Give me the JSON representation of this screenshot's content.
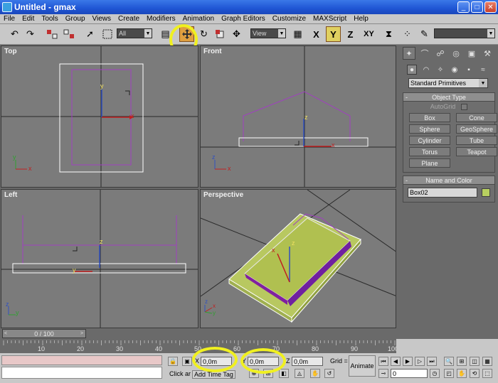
{
  "window": {
    "title": "Untitled - gmax",
    "minimize": "_",
    "maximize": "□",
    "close": "✕"
  },
  "menu": [
    "File",
    "Edit",
    "Tools",
    "Group",
    "Views",
    "Create",
    "Modifiers",
    "Animation",
    "Graph Editors",
    "Customize",
    "MAXScript",
    "Help"
  ],
  "toolbar": {
    "selection_filter": "All",
    "reference_coord": "View",
    "axis_x": "X",
    "axis_y": "Y",
    "axis_z": "Z",
    "axis_xy": "XY"
  },
  "viewports": {
    "top": "Top",
    "front": "Front",
    "left": "Left",
    "perspective": "Perspective",
    "axis_x": "x",
    "axis_y": "y",
    "axis_z": "z"
  },
  "command_panel": {
    "category": "Standard Primitives",
    "object_type_title": "Object Type",
    "autogrid": "AutoGrid",
    "objects": [
      "Box",
      "Cone",
      "Sphere",
      "GeoSphere",
      "Cylinder",
      "Tube",
      "Torus",
      "Teapot",
      "Plane"
    ],
    "name_color_title": "Name and Color",
    "object_name": "Box02",
    "object_color": "#b8d060",
    "rollout_toggle": "-"
  },
  "timeline": {
    "frame_display": "0 / 100",
    "ticks": [
      "10",
      "20",
      "30",
      "40",
      "50",
      "60",
      "70",
      "80",
      "90",
      "100"
    ],
    "prev_arrow": "<",
    "next_arrow": ">"
  },
  "status": {
    "prompt": "Click ar",
    "add_time_tag": "Add Time Tag",
    "x_label": "X",
    "y_label": "Y",
    "z_label": "Z",
    "x_value": "0,0m",
    "y_value": "0,0m",
    "z_value": "0,0m",
    "grid_label": "Grid =",
    "animate": "Animate",
    "current_frame": "0"
  },
  "highlight_color": "#f0f020"
}
